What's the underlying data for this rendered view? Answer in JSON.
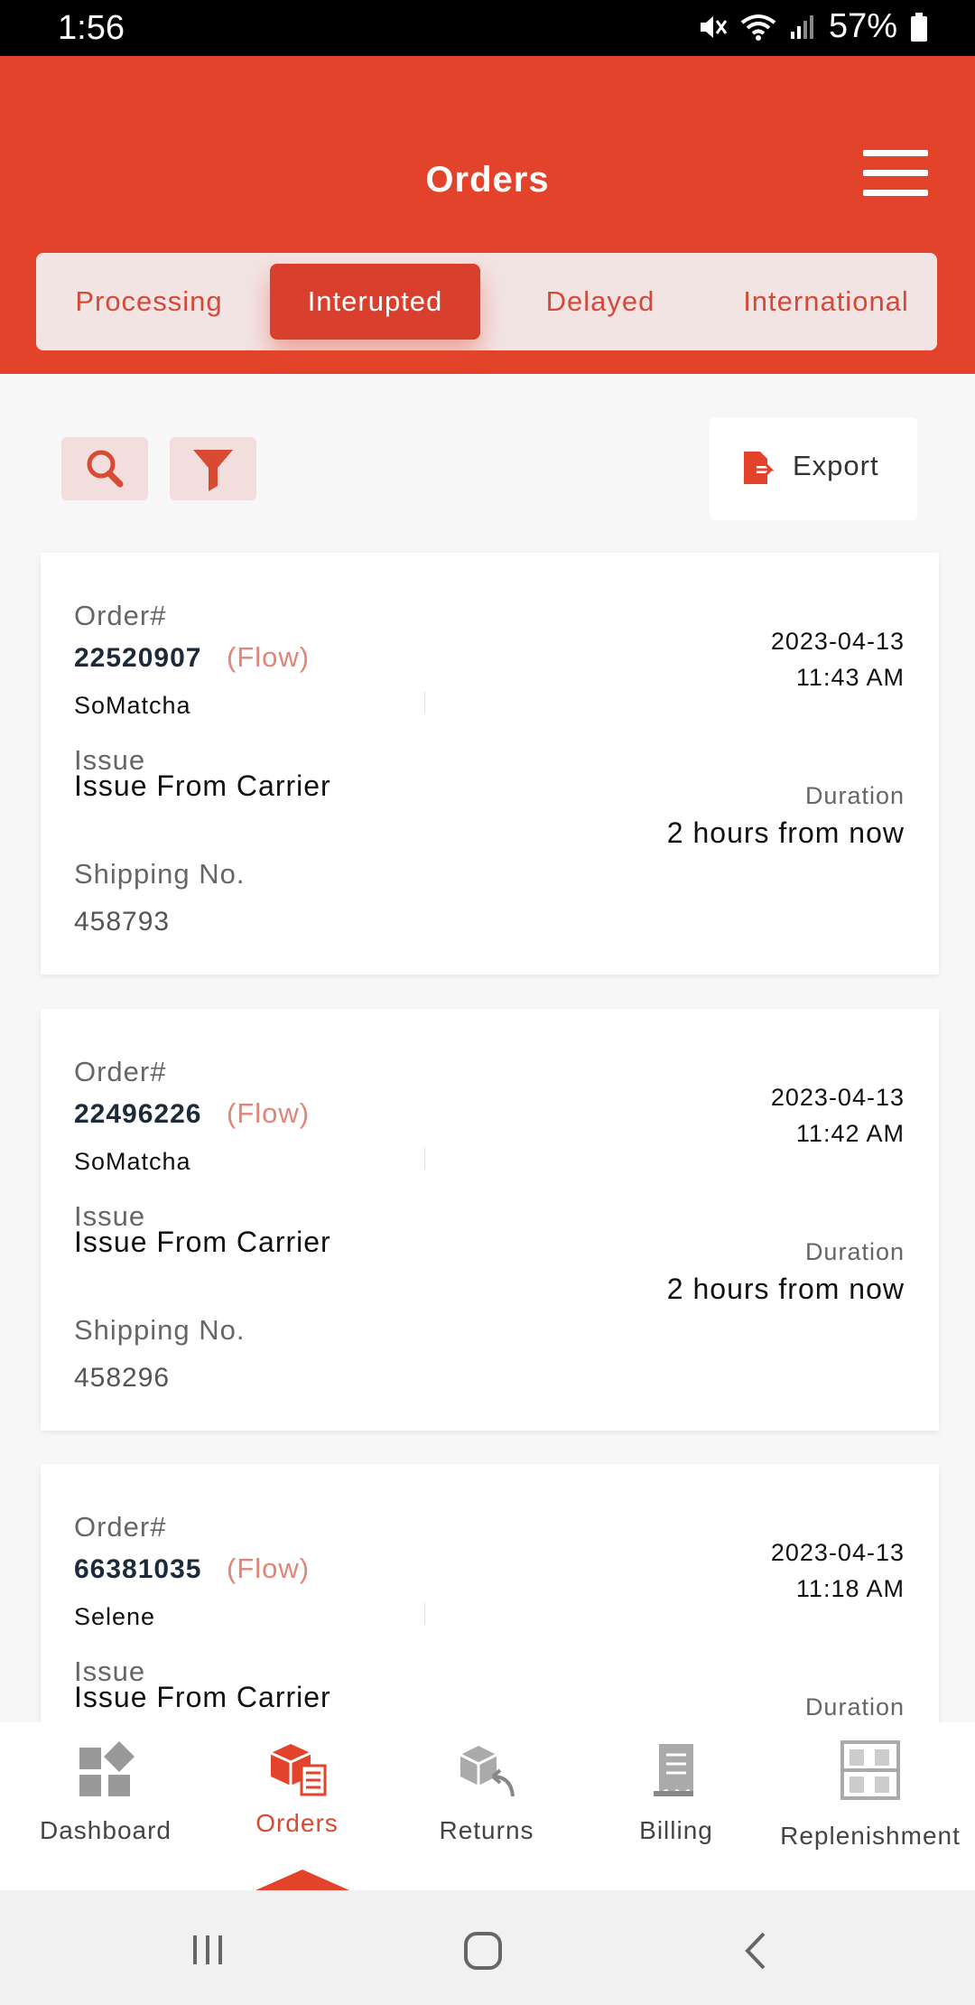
{
  "status_bar": {
    "time": "1:56",
    "battery": "57%"
  },
  "header": {
    "title": "Orders"
  },
  "tabs": [
    {
      "label": "Processing",
      "active": false
    },
    {
      "label": "Interupted",
      "active": true
    },
    {
      "label": "Delayed",
      "active": false
    },
    {
      "label": "International",
      "active": false
    }
  ],
  "toolbar": {
    "export_label": "Export"
  },
  "labels": {
    "order": "Order#",
    "issue": "Issue",
    "duration": "Duration",
    "shipping": "Shipping No."
  },
  "orders": [
    {
      "number": "22520907",
      "type": "(Flow)",
      "store": "SoMatcha",
      "date": "2023-04-13",
      "time": "11:43 AM",
      "issue": "Issue From Carrier",
      "duration": "2 hours from now",
      "shipping_no": "458793"
    },
    {
      "number": "22496226",
      "type": "(Flow)",
      "store": "SoMatcha",
      "date": "2023-04-13",
      "time": "11:42 AM",
      "issue": "Issue From Carrier",
      "duration": "2 hours from now",
      "shipping_no": "458296"
    },
    {
      "number": "66381035",
      "type": "(Flow)",
      "store": "Selene",
      "date": "2023-04-13",
      "time": "11:18 AM",
      "issue": "Issue From Carrier",
      "duration": "",
      "shipping_no": ""
    }
  ],
  "bottom_nav": [
    {
      "label": "Dashboard",
      "icon": "dashboard-icon"
    },
    {
      "label": "Orders",
      "icon": "orders-icon",
      "active": true
    },
    {
      "label": "Returns",
      "icon": "returns-icon"
    },
    {
      "label": "Billing",
      "icon": "billing-icon"
    },
    {
      "label": "Replenishment",
      "icon": "replenishment-icon"
    }
  ],
  "colors": {
    "accent": "#e2432a",
    "flow": "#e08577",
    "active_tab": "#d93f2d"
  }
}
